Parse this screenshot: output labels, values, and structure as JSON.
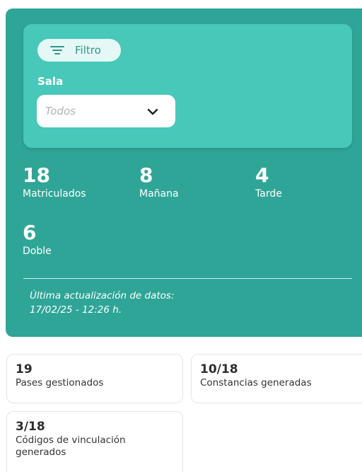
{
  "filter": {
    "chip_label": "Filtro",
    "sala_label": "Sala",
    "sala_placeholder": "Todos",
    "chip_icon": "filter-lines-icon",
    "dropdown_icon": "chevron-down-icon"
  },
  "stats": [
    {
      "value": "18",
      "label": "Matriculados"
    },
    {
      "value": "8",
      "label": "Mañana"
    },
    {
      "value": "4",
      "label": "Tarde"
    },
    {
      "value": "6",
      "label": "Doble"
    }
  ],
  "update": {
    "line1": "Última actualización de datos:",
    "line2": "17/02/25 - 12:26 h."
  },
  "cards": [
    {
      "value": "19",
      "label": "Pases gestionados"
    },
    {
      "value": "10/18",
      "label": "Constancias generadas"
    },
    {
      "value": "3/18",
      "label": "Códigos de vinculación generados"
    }
  ],
  "colors": {
    "panel": "#2fa597",
    "filter_card": "#47c8b8",
    "chip_bg": "#e6f8f5",
    "chip_text": "#2a9a8c"
  }
}
